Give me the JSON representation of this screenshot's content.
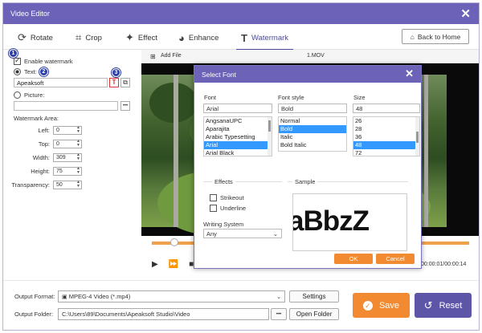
{
  "window": {
    "title": "Video Editor"
  },
  "toolbar": {
    "tabs": [
      {
        "label": "Rotate",
        "icon": "rotate-icon"
      },
      {
        "label": "Crop",
        "icon": "crop-icon"
      },
      {
        "label": "Effect",
        "icon": "effect-icon"
      },
      {
        "label": "Enhance",
        "icon": "palette-icon"
      },
      {
        "label": "Watermark",
        "icon": "text-icon",
        "active": true
      }
    ],
    "back_label": "Back to Home"
  },
  "watermark": {
    "enable_label": "Enable watermark",
    "text_label": "Text:",
    "text_value": "Apeaksoft",
    "picture_label": "Picture:",
    "area_label": "Watermark Area:",
    "fields": [
      {
        "label": "Left:",
        "value": "0"
      },
      {
        "label": "Top:",
        "value": "0"
      },
      {
        "label": "Width:",
        "value": "309"
      },
      {
        "label": "Height:",
        "value": "75"
      },
      {
        "label": "Transparency:",
        "value": "50"
      }
    ],
    "badges": [
      "1",
      "2",
      "3"
    ]
  },
  "video": {
    "add_file_label": "Add File",
    "file_name": "1.MOV",
    "timecode": "00:00:01/00:00:14",
    "progress": 0.07
  },
  "dialog": {
    "title": "Select Font",
    "font_label": "Font",
    "font_value": "Arial",
    "fonts": [
      "AngsanaUPC",
      "Aparajita",
      "Arabic Typesetting",
      "Arial",
      "Arial Black"
    ],
    "font_selected": "Arial",
    "style_label": "Font style",
    "style_value": "Bold",
    "styles": [
      "Normal",
      "Bold",
      "Italic",
      "Bold Italic"
    ],
    "style_selected": "Bold",
    "size_label": "Size",
    "size_value": "48",
    "sizes": [
      "26",
      "28",
      "36",
      "48",
      "72"
    ],
    "size_selected": "48",
    "effects_label": "Effects",
    "strikeout_label": "Strikeout",
    "underline_label": "Underline",
    "writing_label": "Writing System",
    "writing_value": "Any",
    "sample_label": "Sample",
    "sample_text": "aBbzZ",
    "ok_label": "OK",
    "cancel_label": "Cancel"
  },
  "output": {
    "format_label": "Output Format:",
    "format_value": "MPEG-4 Video (*.mp4)",
    "settings_label": "Settings",
    "folder_label": "Output Folder:",
    "folder_value": "C:\\Users\\89\\Documents\\Apeaksoft Studio\\Video",
    "dots_label": "•••",
    "open_label": "Open Folder",
    "save_label": "Save",
    "reset_label": "Reset"
  },
  "colors": {
    "title_bar": "#6c62b8",
    "save": "#f18a31",
    "reset": "#5c55a8",
    "timeline": "#f0a24b",
    "selection": "#3399ff"
  }
}
